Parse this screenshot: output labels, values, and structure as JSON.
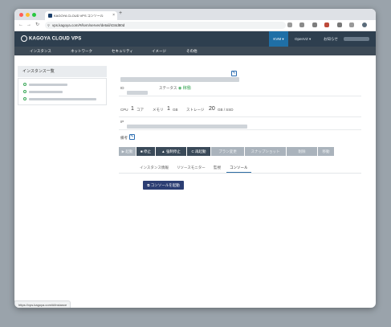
{
  "browser": {
    "tab_title": "KAGOYA CLOUD VPS コンソール",
    "tab_close": "×",
    "new_tab": "+",
    "url": "vps.kagoya.com/#/kvm/server/detail/434d80d",
    "status_url": "https://vps.kagoya.com/#/instance"
  },
  "header": {
    "logo": "KAGOYA CLOUD VPS",
    "kvm": "KVM ▾",
    "openvz": "OpenVZ ▾",
    "notice": "お知らせ"
  },
  "nav": [
    "インスタンス",
    "ネットワーク",
    "セキュリティ",
    "イメージ",
    "その他"
  ],
  "sidebar": {
    "title": "インスタンス一覧"
  },
  "detail": {
    "id_label": "ID",
    "status_label": "ステータス",
    "status_value": "稼働",
    "cpu_label": "CPU",
    "cpu_value": "1",
    "cpu_unit": "コア",
    "memory_label": "メモリ",
    "memory_value": "1",
    "memory_unit": "GB",
    "storage_label": "ストレージ",
    "storage_value": "20",
    "storage_unit": "GB / SSD",
    "ip_label": "IP",
    "memo_label": "備考"
  },
  "actions": [
    "▶ 起動",
    "■ 停止",
    "▲ 強制停止",
    "C 再起動",
    "プラン変更",
    "スナップショット",
    "削除",
    "移動"
  ],
  "tabs": [
    "インスタンス情報",
    "リソースモニター",
    "監視",
    "コンソール"
  ],
  "console_button": "コンソールを起動",
  "colors": {
    "header": "#2e3f4f",
    "nav": "#3d4a56",
    "accent": "#1f6fa6",
    "status_ok": "#3aa757"
  }
}
